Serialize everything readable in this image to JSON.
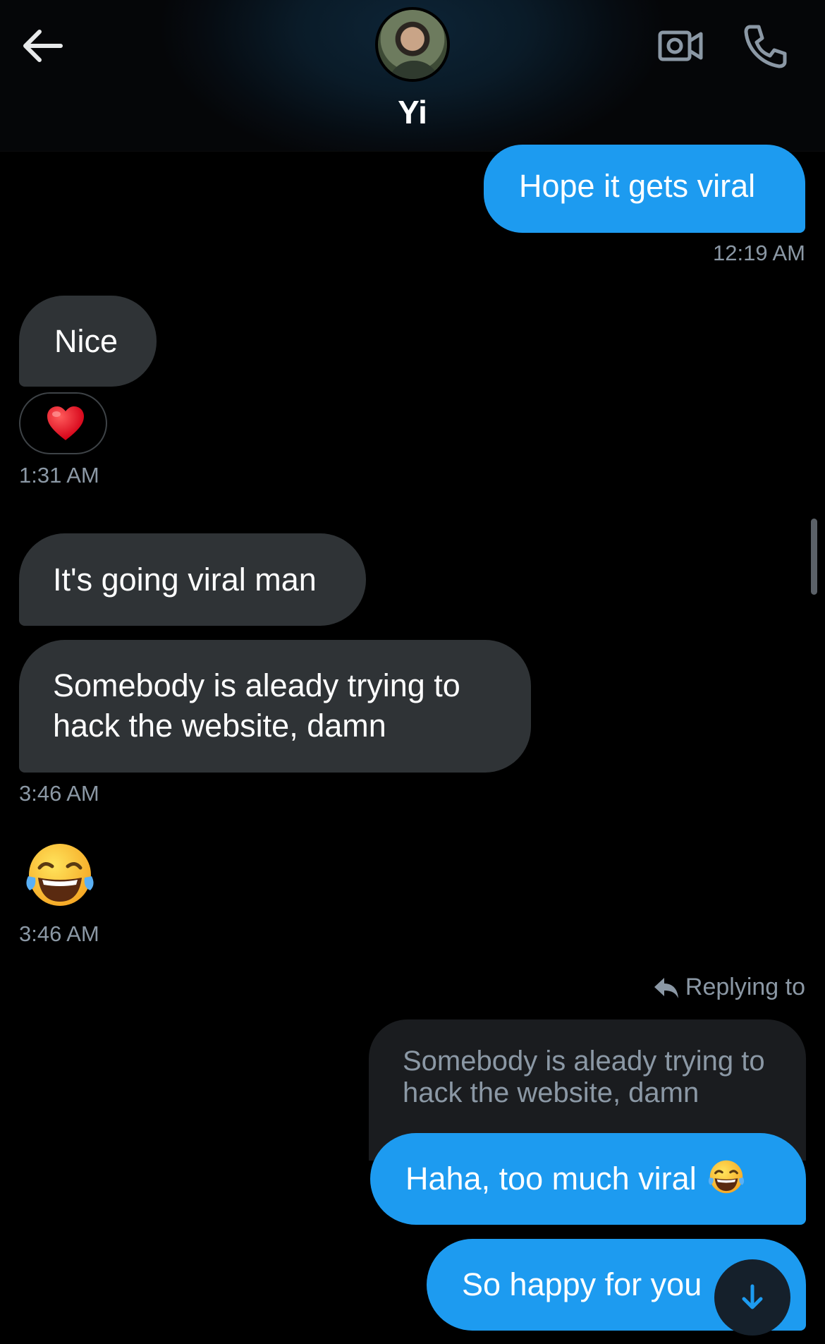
{
  "header": {
    "contact_name": "Yi"
  },
  "messages": [
    {
      "from": "me",
      "text": "Hope it gets viral",
      "time": "12:19 AM"
    },
    {
      "from": "them",
      "text": "Nice",
      "reaction": "heart-emoji",
      "time": "1:31 AM"
    },
    {
      "from": "them",
      "text": "It's going viral man"
    },
    {
      "from": "them",
      "text": "Somebody is aleady trying to hack the website, damn",
      "time": "3:46 AM"
    },
    {
      "from": "them",
      "emoji": "face-with-tears-of-joy-emoji",
      "time": "3:46 AM"
    },
    {
      "from": "me",
      "text": "Haha, too much viral",
      "emoji": "face-with-tears-of-joy-emoji"
    },
    {
      "from": "me",
      "text": "So happy for you"
    }
  ],
  "reply": {
    "label": "Replying to",
    "quoted_text": "Somebody is aleady trying to hack the website, damn"
  },
  "colors": {
    "outgoing_bubble": "#1d9bf0",
    "incoming_bubble": "#2f3336",
    "background": "#000000",
    "timestamp": "#8b98a5"
  },
  "icons": [
    "back-arrow-icon",
    "video-call-icon",
    "phone-call-icon",
    "reply-arrow-icon",
    "arrow-down-icon"
  ]
}
